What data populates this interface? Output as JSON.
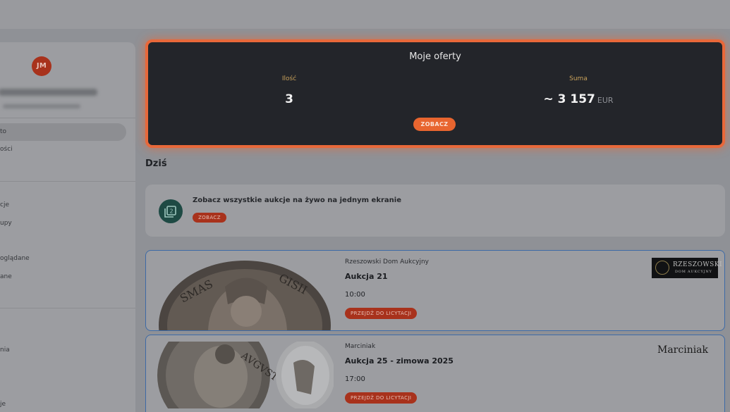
{
  "sidebar": {
    "avatar_initials": "JM",
    "items": [
      {
        "label": "to"
      },
      {
        "label": "ości"
      },
      {
        "label": "cje"
      },
      {
        "label": "upy"
      },
      {
        "label": "oglądane"
      },
      {
        "label": "ane"
      },
      {
        "label": "nia"
      },
      {
        "label": "je"
      }
    ]
  },
  "offers": {
    "title": "Moje oferty",
    "count_label": "Ilość",
    "count_value": "3",
    "sum_label": "Suma",
    "sum_value": "~ 3 157",
    "sum_unit": "EUR",
    "button_label": "ZOBACZ"
  },
  "today": {
    "title": "Dziś"
  },
  "live_banner": {
    "text": "Zobacz wszystkie aukcje na żywo na jednym ekranie",
    "button_label": "ZOBACZ"
  },
  "auctions": [
    {
      "house": "Rzeszowski Dom Aukcyjny",
      "title": "Aukcja 21",
      "time": "10:00",
      "button_label": "PRZEJDŹ DO LICYTACJI",
      "logo_line1": "RZESZOWSKI",
      "logo_line2": "DOM AUKCYJNY"
    },
    {
      "house": "Marciniak",
      "title": "Aukcja 25 - zimowa 2025",
      "time": "17:00",
      "button_label": "PRZEJDŹ DO LICYTACJI",
      "logo_text": "Marciniak"
    }
  ],
  "colors": {
    "accent_orange": "#e8683a",
    "button_red": "#a8321c",
    "panel_dark": "#23252a",
    "card_border_blue": "#3d6aa6"
  }
}
